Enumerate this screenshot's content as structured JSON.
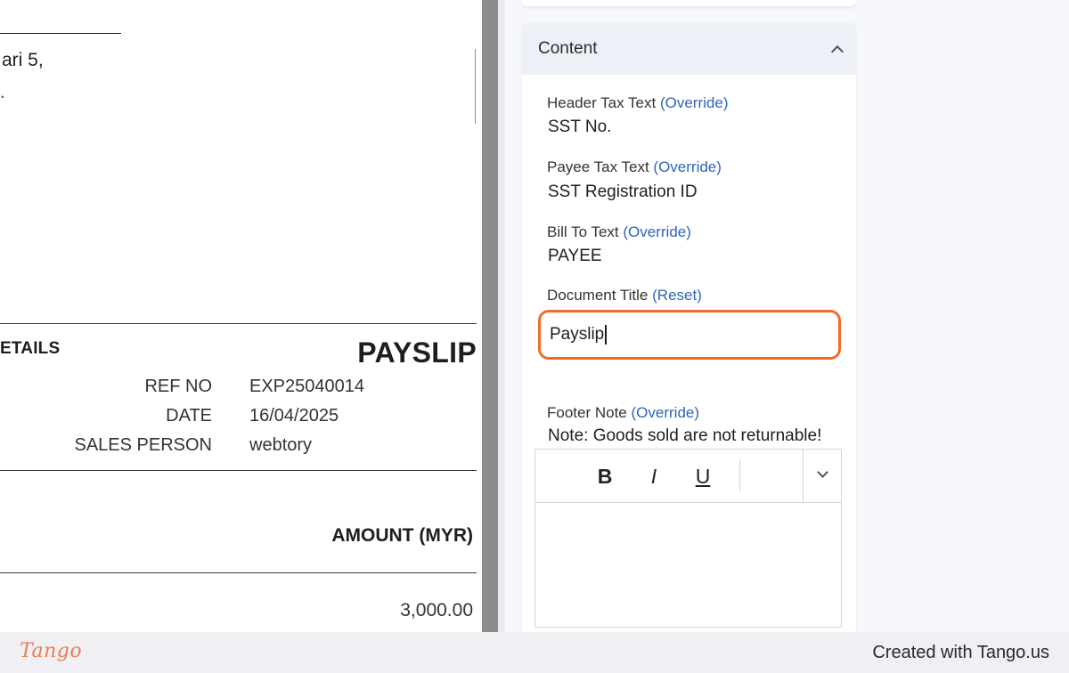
{
  "document": {
    "address_line1": "ari 5,",
    "address_line2": ".",
    "details_heading": "ETAILS",
    "title": "PAYSLIP",
    "meta": [
      {
        "label": "REF NO",
        "value": "EXP25040014"
      },
      {
        "label": "DATE",
        "value": "16/04/2025"
      },
      {
        "label": "SALES PERSON",
        "value": "webtory"
      }
    ],
    "amount_header": "AMOUNT (MYR)",
    "amount_value": "3,000.00"
  },
  "panel": {
    "section_title": "Content",
    "header_tax": {
      "label": "Header Tax Text",
      "action": "(Override)",
      "value": "SST No."
    },
    "payee_tax": {
      "label": "Payee Tax Text",
      "action": "(Override)",
      "value": "SST Registration ID"
    },
    "bill_to": {
      "label": "Bill To Text",
      "action": "(Override)",
      "value": "PAYEE"
    },
    "document_title": {
      "label": "Document Title",
      "action": "(Reset)",
      "value": "Payslip"
    },
    "footer_note": {
      "label": "Footer Note",
      "action": "(Override)",
      "value": "Note: Goods sold are not returnable!"
    },
    "toolbar": {
      "bold": "B",
      "italic": "I",
      "underline": "U"
    }
  },
  "footer": {
    "brand": "Tango",
    "credit": "Created with Tango.us"
  },
  "colors": {
    "focus_border": "#f26a2a",
    "link": "#2f64b8",
    "brand": "#ee7a52"
  }
}
